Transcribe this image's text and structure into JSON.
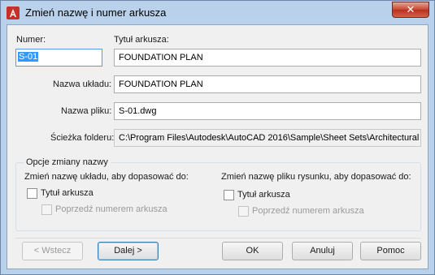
{
  "window": {
    "title": "Zmień nazwę i numer arkusza",
    "close_symbol": "✕",
    "icon": "autocad-icon",
    "accent_color": "#c7302a"
  },
  "form": {
    "numer_label": "Numer:",
    "numer_value": "S-01",
    "tytul_label": "Tytuł arkusza:",
    "tytul_value": "FOUNDATION PLAN",
    "uklad_label": "Nazwa układu:",
    "uklad_value": "FOUNDATION PLAN",
    "plik_label": "Nazwa pliku:",
    "plik_value": "S-01.dwg",
    "sciezka_label": "Ścieżka folderu:",
    "sciezka_value": "C:\\Program Files\\Autodesk\\AutoCAD 2016\\Sample\\Sheet Sets\\Architectural"
  },
  "options": {
    "group_title": "Opcje zmiany nazwy",
    "layout_heading": "Zmień nazwę układu, aby dopasować do:",
    "layout_title_checkbox": "Tytuł arkusza",
    "layout_prefix_checkbox": "Poprzedź numerem arkusza",
    "file_heading": "Zmień nazwę pliku rysunku, aby dopasować do:",
    "file_title_checkbox": "Tytuł arkusza",
    "file_prefix_checkbox": "Poprzedź numerem arkusza"
  },
  "buttons": {
    "back": "< Wstecz",
    "next": "Dalej >",
    "ok": "OK",
    "cancel": "Anuluj",
    "help": "Pomoc"
  }
}
